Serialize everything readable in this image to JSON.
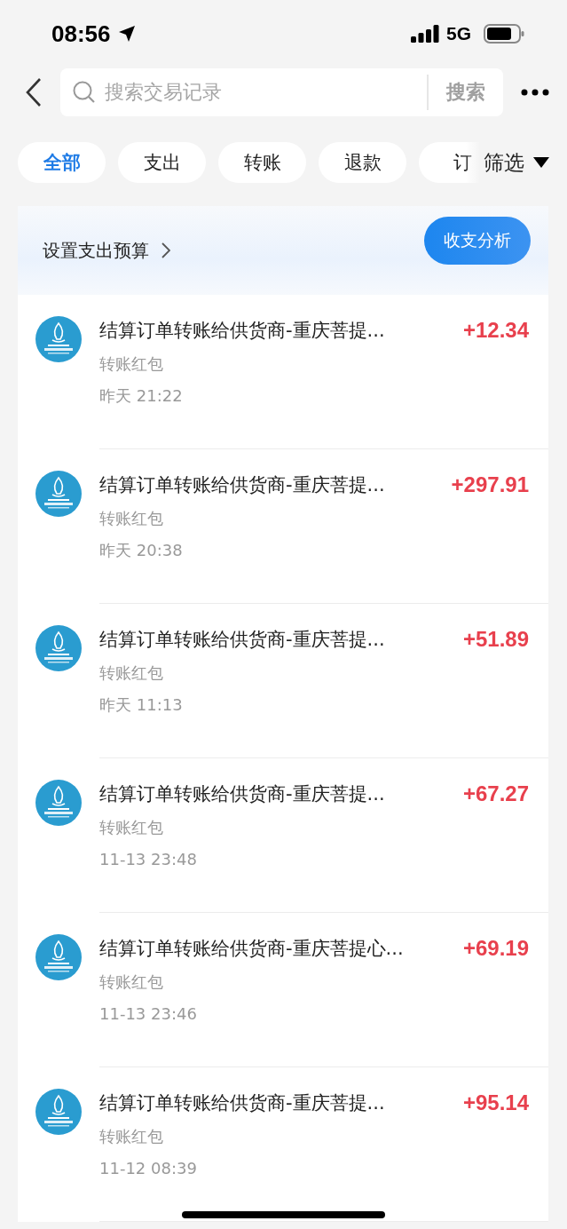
{
  "status_bar": {
    "time": "08:56",
    "network": "5G"
  },
  "search": {
    "placeholder": "搜索交易记录",
    "button": "搜索"
  },
  "chips": [
    {
      "label": "全部",
      "selected": true
    },
    {
      "label": "支出",
      "selected": false
    },
    {
      "label": "转账",
      "selected": false
    },
    {
      "label": "退款",
      "selected": false
    },
    {
      "label": "订",
      "selected": false
    }
  ],
  "filter": "筛选",
  "budget": {
    "link": "设置支出预算",
    "button": "收支分析"
  },
  "transactions": [
    {
      "title": "结算订单转账给供货商-重庆菩提...",
      "category": "转账红包",
      "time": "昨天 21:22",
      "amount": "+12.34"
    },
    {
      "title": "结算订单转账给供货商-重庆菩提...",
      "category": "转账红包",
      "time": "昨天 20:38",
      "amount": "+297.91"
    },
    {
      "title": "结算订单转账给供货商-重庆菩提...",
      "category": "转账红包",
      "time": "昨天 11:13",
      "amount": "+51.89"
    },
    {
      "title": "结算订单转账给供货商-重庆菩提...",
      "category": "转账红包",
      "time": "11-13 23:48",
      "amount": "+67.27"
    },
    {
      "title": "结算订单转账给供货商-重庆菩提心...",
      "category": "转账红包",
      "time": "11-13 23:46",
      "amount": "+69.19"
    },
    {
      "title": "结算订单转账给供货商-重庆菩提...",
      "category": "转账红包",
      "time": "11-12 08:39",
      "amount": "+95.14"
    }
  ]
}
